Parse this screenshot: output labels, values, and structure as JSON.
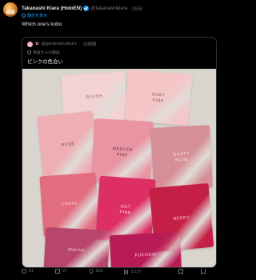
{
  "author": {
    "name": "Takanashi Kiara (HoloEN)",
    "handle": "@takanashikiara",
    "time": "25分"
  },
  "translate_label": "翻訳を表示",
  "tweet_text": "Which one's kobo",
  "quote": {
    "handle": "@gardenofcolours",
    "time": "15時間",
    "translated_label": "英語からの翻訳",
    "text": "ピンクの色合い"
  },
  "swatches": [
    {
      "label": "BLUSH"
    },
    {
      "label": "BABY\nPINK"
    },
    {
      "label": "ROSE"
    },
    {
      "label": "MEDIUM\nPINK"
    },
    {
      "label": "DUSTY\nROSE"
    },
    {
      "label": "CORAL"
    },
    {
      "label": "HOT\nPINK"
    },
    {
      "label": "BERRY"
    },
    {
      "label": "MAUVE"
    },
    {
      "label": "FUCHSIA"
    }
  ],
  "swatch_colors": [
    "#f2d2d2",
    "#f4c6c8",
    "#eeaeb4",
    "#ea93a3",
    "#d68f97",
    "#e26d7e",
    "#dd2f63",
    "#c42045",
    "#b8456b",
    "#b81c56"
  ],
  "actions": {
    "replies": "51",
    "reposts": "27",
    "likes": "523",
    "views": "2.1万"
  },
  "colors": {
    "accent": "#1d9bf0",
    "background": "#000000"
  }
}
